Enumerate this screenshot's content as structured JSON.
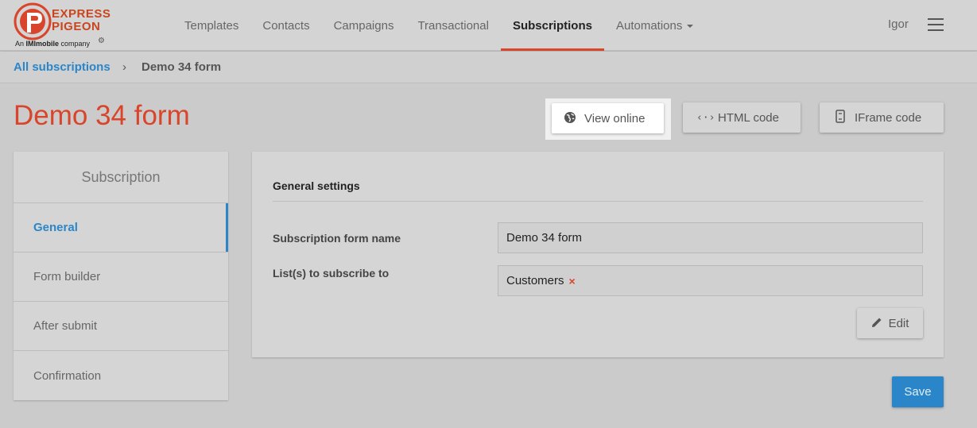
{
  "brand": {
    "logo_line1": "EXPRESS",
    "logo_line2": "PIGEON",
    "sub_prefix": "An ",
    "sub_brand": "IMImobile",
    "sub_suffix": " company",
    "accent_color": "#d9452b",
    "link_color": "#2a86c8"
  },
  "nav": {
    "items": [
      {
        "label": "Templates"
      },
      {
        "label": "Contacts"
      },
      {
        "label": "Campaigns"
      },
      {
        "label": "Transactional"
      },
      {
        "label": "Subscriptions"
      },
      {
        "label": "Automations"
      }
    ],
    "active": "Subscriptions",
    "user": "Igor"
  },
  "breadcrumb": {
    "parent": "All subscriptions",
    "current": "Demo 34 form"
  },
  "page": {
    "title": "Demo 34 form"
  },
  "actions": {
    "view_online": "View online",
    "html_code": "HTML code",
    "iframe_code": "IFrame code"
  },
  "sidebar": {
    "title": "Subscription",
    "items": [
      {
        "label": "General"
      },
      {
        "label": "Form builder"
      },
      {
        "label": "After submit"
      },
      {
        "label": "Confirmation"
      }
    ],
    "active": "General"
  },
  "settings": {
    "heading": "General settings",
    "form_name_label": "Subscription form name",
    "form_name_value": "Demo 34 form",
    "lists_label": "List(s) to subscribe to",
    "lists": [
      "Customers"
    ],
    "edit_label": "Edit"
  },
  "save_label": "Save"
}
